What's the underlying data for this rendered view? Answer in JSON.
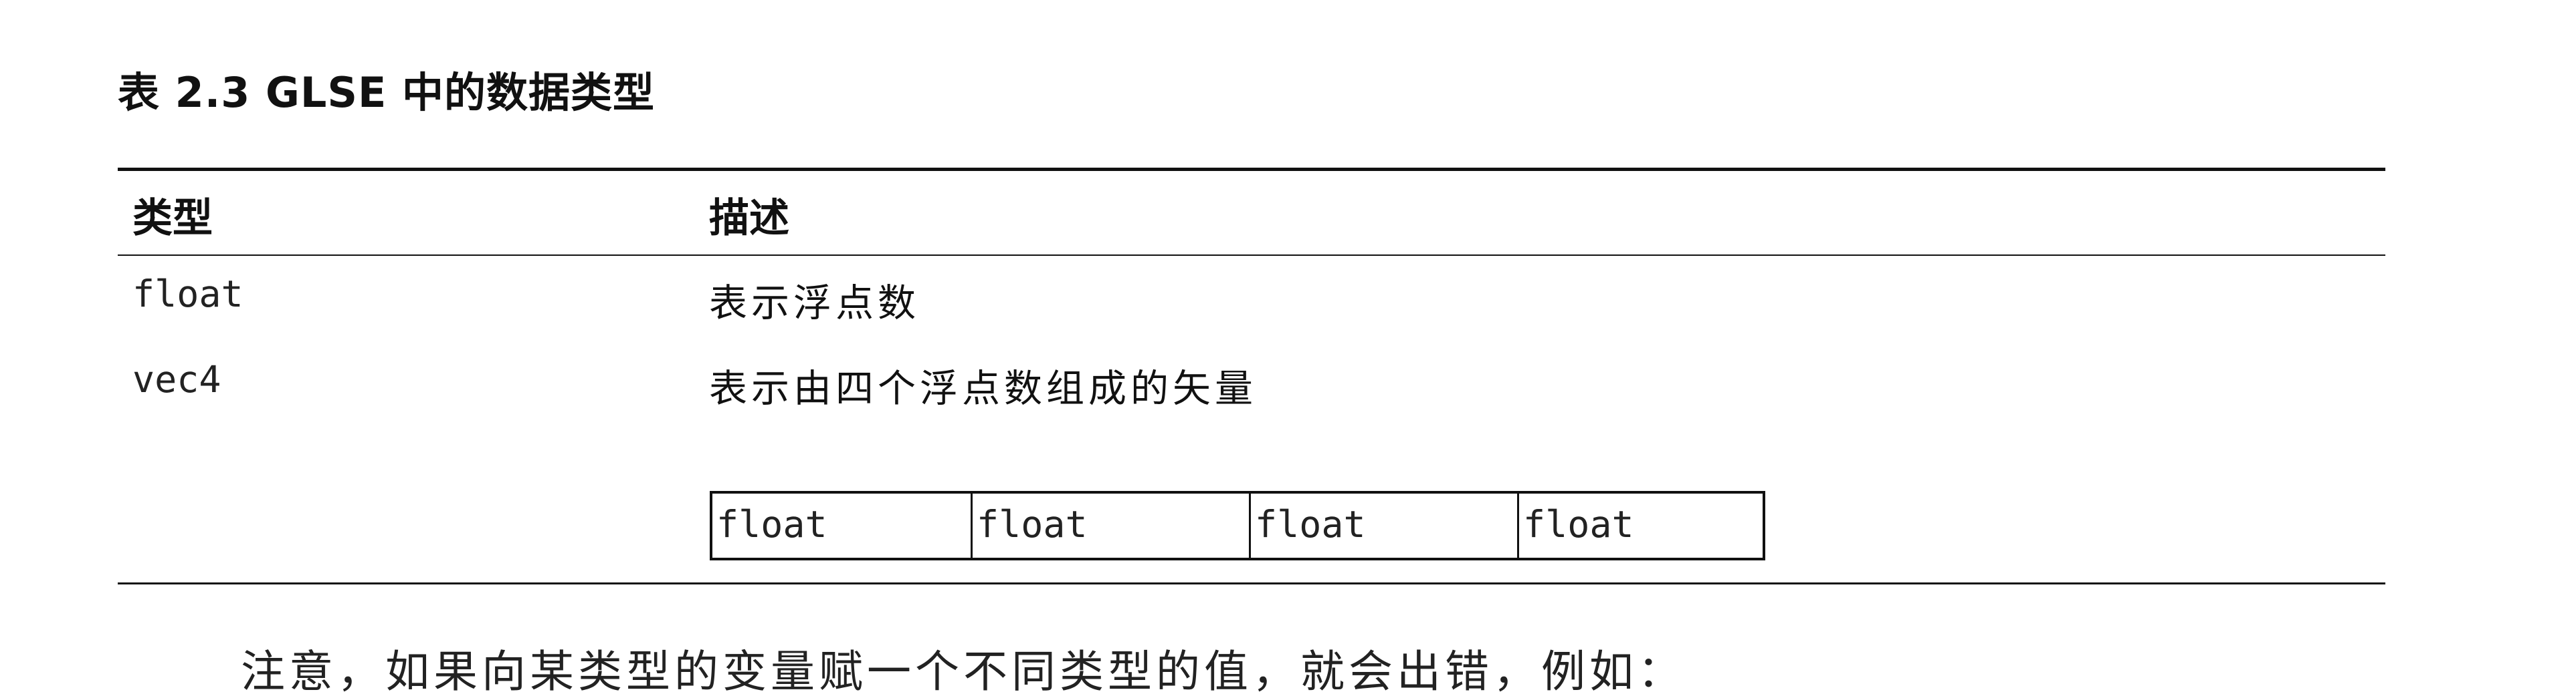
{
  "caption": "表 2.3  GLSE 中的数据类型",
  "table": {
    "headers": {
      "type": "类型",
      "description": "描述"
    },
    "rows": [
      {
        "type": "float",
        "description": "表示浮点数"
      },
      {
        "type": "vec4",
        "description": "表示由四个浮点数组成的矢量"
      }
    ],
    "vec4_cells": [
      "float",
      "float",
      "float",
      "float"
    ]
  },
  "body_text_partial": "注意，如果向某类型的变量赋一个不同类型的值，就会出错，例如："
}
